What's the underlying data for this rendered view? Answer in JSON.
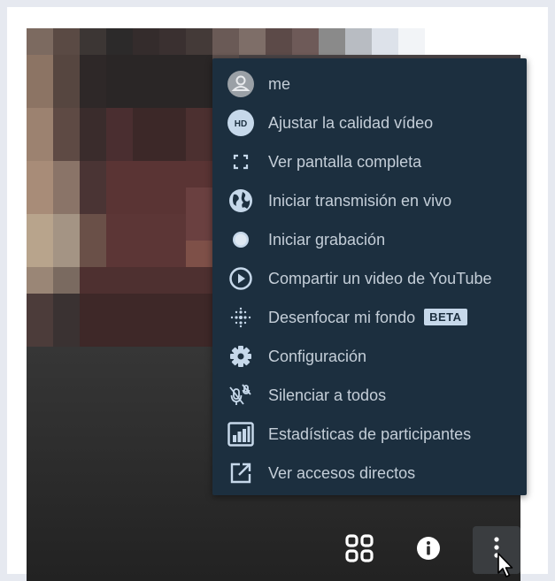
{
  "menu": {
    "items": [
      {
        "label": "me",
        "icon": "avatar-icon"
      },
      {
        "label": "Ajustar la calidad vídeo",
        "icon": "hd-icon"
      },
      {
        "label": "Ver pantalla completa",
        "icon": "fullscreen-icon"
      },
      {
        "label": "Iniciar transmisión en vivo",
        "icon": "globe-icon"
      },
      {
        "label": "Iniciar grabación",
        "icon": "record-icon"
      },
      {
        "label": "Compartir un video de YouTube",
        "icon": "play-circle-icon"
      },
      {
        "label": "Desenfocar mi fondo",
        "icon": "blur-icon",
        "badge": "BETA"
      },
      {
        "label": "Configuración",
        "icon": "gear-icon"
      },
      {
        "label": "Silenciar a todos",
        "icon": "mute-all-icon"
      },
      {
        "label": "Estadísticas de participantes",
        "icon": "stats-icon"
      },
      {
        "label": "Ver accesos directos",
        "icon": "external-link-icon"
      }
    ],
    "hd_text": "HD"
  },
  "toolbar": {
    "buttons": [
      {
        "icon": "tile-view-icon"
      },
      {
        "icon": "info-icon"
      },
      {
        "icon": "more-vertical-icon"
      }
    ]
  },
  "colors": {
    "menu_bg": "#1c2f3f",
    "menu_text": "#c4ced8",
    "icon": "#c6d8ea"
  }
}
